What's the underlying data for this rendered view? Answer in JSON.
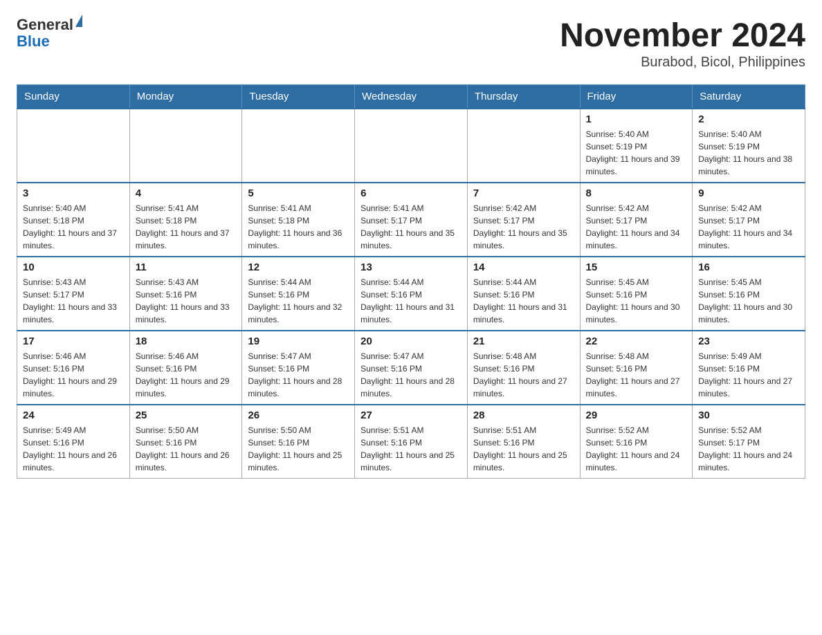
{
  "header": {
    "logo_general": "General",
    "logo_blue": "Blue",
    "month_title": "November 2024",
    "location": "Burabod, Bicol, Philippines"
  },
  "days_of_week": [
    "Sunday",
    "Monday",
    "Tuesday",
    "Wednesday",
    "Thursday",
    "Friday",
    "Saturday"
  ],
  "weeks": [
    {
      "days": [
        {
          "number": "",
          "info": ""
        },
        {
          "number": "",
          "info": ""
        },
        {
          "number": "",
          "info": ""
        },
        {
          "number": "",
          "info": ""
        },
        {
          "number": "",
          "info": ""
        },
        {
          "number": "1",
          "info": "Sunrise: 5:40 AM\nSunset: 5:19 PM\nDaylight: 11 hours and 39 minutes."
        },
        {
          "number": "2",
          "info": "Sunrise: 5:40 AM\nSunset: 5:19 PM\nDaylight: 11 hours and 38 minutes."
        }
      ]
    },
    {
      "days": [
        {
          "number": "3",
          "info": "Sunrise: 5:40 AM\nSunset: 5:18 PM\nDaylight: 11 hours and 37 minutes."
        },
        {
          "number": "4",
          "info": "Sunrise: 5:41 AM\nSunset: 5:18 PM\nDaylight: 11 hours and 37 minutes."
        },
        {
          "number": "5",
          "info": "Sunrise: 5:41 AM\nSunset: 5:18 PM\nDaylight: 11 hours and 36 minutes."
        },
        {
          "number": "6",
          "info": "Sunrise: 5:41 AM\nSunset: 5:17 PM\nDaylight: 11 hours and 35 minutes."
        },
        {
          "number": "7",
          "info": "Sunrise: 5:42 AM\nSunset: 5:17 PM\nDaylight: 11 hours and 35 minutes."
        },
        {
          "number": "8",
          "info": "Sunrise: 5:42 AM\nSunset: 5:17 PM\nDaylight: 11 hours and 34 minutes."
        },
        {
          "number": "9",
          "info": "Sunrise: 5:42 AM\nSunset: 5:17 PM\nDaylight: 11 hours and 34 minutes."
        }
      ]
    },
    {
      "days": [
        {
          "number": "10",
          "info": "Sunrise: 5:43 AM\nSunset: 5:17 PM\nDaylight: 11 hours and 33 minutes."
        },
        {
          "number": "11",
          "info": "Sunrise: 5:43 AM\nSunset: 5:16 PM\nDaylight: 11 hours and 33 minutes."
        },
        {
          "number": "12",
          "info": "Sunrise: 5:44 AM\nSunset: 5:16 PM\nDaylight: 11 hours and 32 minutes."
        },
        {
          "number": "13",
          "info": "Sunrise: 5:44 AM\nSunset: 5:16 PM\nDaylight: 11 hours and 31 minutes."
        },
        {
          "number": "14",
          "info": "Sunrise: 5:44 AM\nSunset: 5:16 PM\nDaylight: 11 hours and 31 minutes."
        },
        {
          "number": "15",
          "info": "Sunrise: 5:45 AM\nSunset: 5:16 PM\nDaylight: 11 hours and 30 minutes."
        },
        {
          "number": "16",
          "info": "Sunrise: 5:45 AM\nSunset: 5:16 PM\nDaylight: 11 hours and 30 minutes."
        }
      ]
    },
    {
      "days": [
        {
          "number": "17",
          "info": "Sunrise: 5:46 AM\nSunset: 5:16 PM\nDaylight: 11 hours and 29 minutes."
        },
        {
          "number": "18",
          "info": "Sunrise: 5:46 AM\nSunset: 5:16 PM\nDaylight: 11 hours and 29 minutes."
        },
        {
          "number": "19",
          "info": "Sunrise: 5:47 AM\nSunset: 5:16 PM\nDaylight: 11 hours and 28 minutes."
        },
        {
          "number": "20",
          "info": "Sunrise: 5:47 AM\nSunset: 5:16 PM\nDaylight: 11 hours and 28 minutes."
        },
        {
          "number": "21",
          "info": "Sunrise: 5:48 AM\nSunset: 5:16 PM\nDaylight: 11 hours and 27 minutes."
        },
        {
          "number": "22",
          "info": "Sunrise: 5:48 AM\nSunset: 5:16 PM\nDaylight: 11 hours and 27 minutes."
        },
        {
          "number": "23",
          "info": "Sunrise: 5:49 AM\nSunset: 5:16 PM\nDaylight: 11 hours and 27 minutes."
        }
      ]
    },
    {
      "days": [
        {
          "number": "24",
          "info": "Sunrise: 5:49 AM\nSunset: 5:16 PM\nDaylight: 11 hours and 26 minutes."
        },
        {
          "number": "25",
          "info": "Sunrise: 5:50 AM\nSunset: 5:16 PM\nDaylight: 11 hours and 26 minutes."
        },
        {
          "number": "26",
          "info": "Sunrise: 5:50 AM\nSunset: 5:16 PM\nDaylight: 11 hours and 25 minutes."
        },
        {
          "number": "27",
          "info": "Sunrise: 5:51 AM\nSunset: 5:16 PM\nDaylight: 11 hours and 25 minutes."
        },
        {
          "number": "28",
          "info": "Sunrise: 5:51 AM\nSunset: 5:16 PM\nDaylight: 11 hours and 25 minutes."
        },
        {
          "number": "29",
          "info": "Sunrise: 5:52 AM\nSunset: 5:16 PM\nDaylight: 11 hours and 24 minutes."
        },
        {
          "number": "30",
          "info": "Sunrise: 5:52 AM\nSunset: 5:17 PM\nDaylight: 11 hours and 24 minutes."
        }
      ]
    }
  ]
}
